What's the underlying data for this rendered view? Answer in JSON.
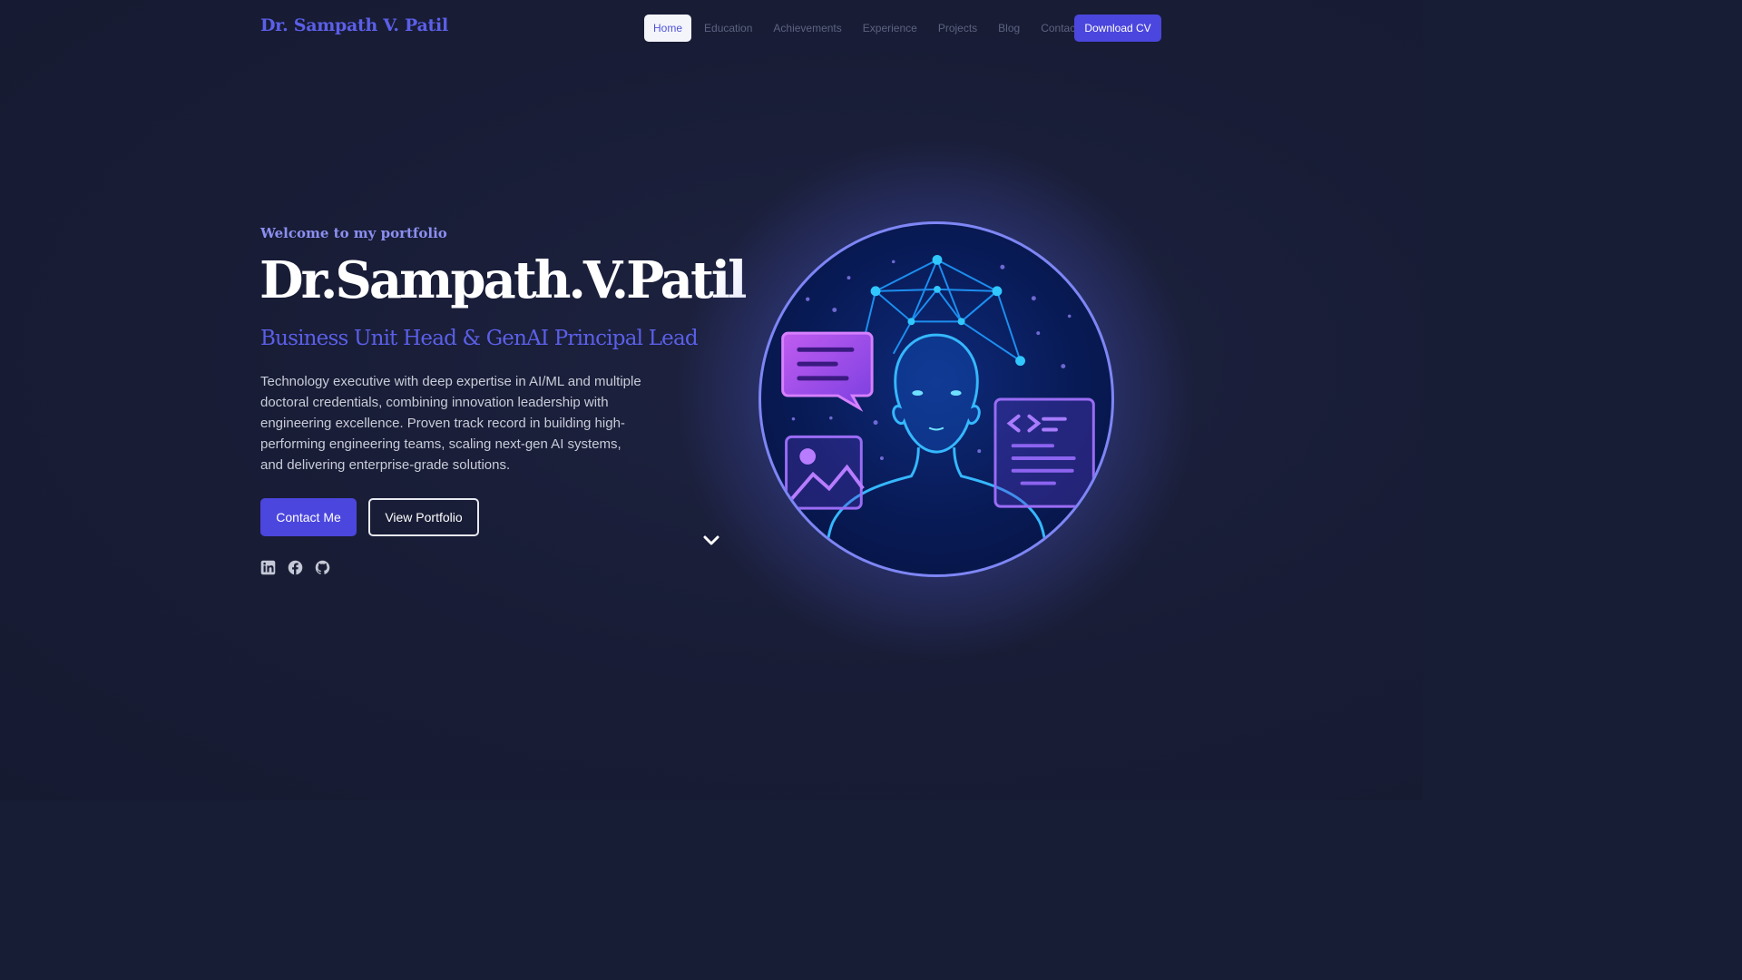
{
  "nav": {
    "brand": "Dr. Sampath V. Patil",
    "items": [
      {
        "label": "Home",
        "active": true
      },
      {
        "label": "Education"
      },
      {
        "label": "Achievements"
      },
      {
        "label": "Experience"
      },
      {
        "label": "Projects"
      },
      {
        "label": "Blog"
      },
      {
        "label": "Contact"
      }
    ],
    "cta": "Download CV"
  },
  "hero": {
    "welcome": "Welcome to my portfolio",
    "name": "Dr.Sampath.V.Patil",
    "role": "Business Unit Head & GenAI Principal Lead",
    "bio": "Technology executive with deep expertise in AI/ML and multiple doctoral credentials, combining innovation leadership with engineering excellence. Proven track record in building high-performing engineering teams, scaling next-gen AI systems, and delivering enterprise-grade solutions.",
    "buttons": {
      "contact": "Contact Me",
      "portfolio": "View Portfolio"
    },
    "socials": [
      "linkedin-icon",
      "facebook-icon",
      "github-icon"
    ]
  },
  "colors": {
    "accent": "#4b46dd",
    "brand": "#5b5fe8",
    "background": "#181d36",
    "ring": "#7e86f5"
  }
}
